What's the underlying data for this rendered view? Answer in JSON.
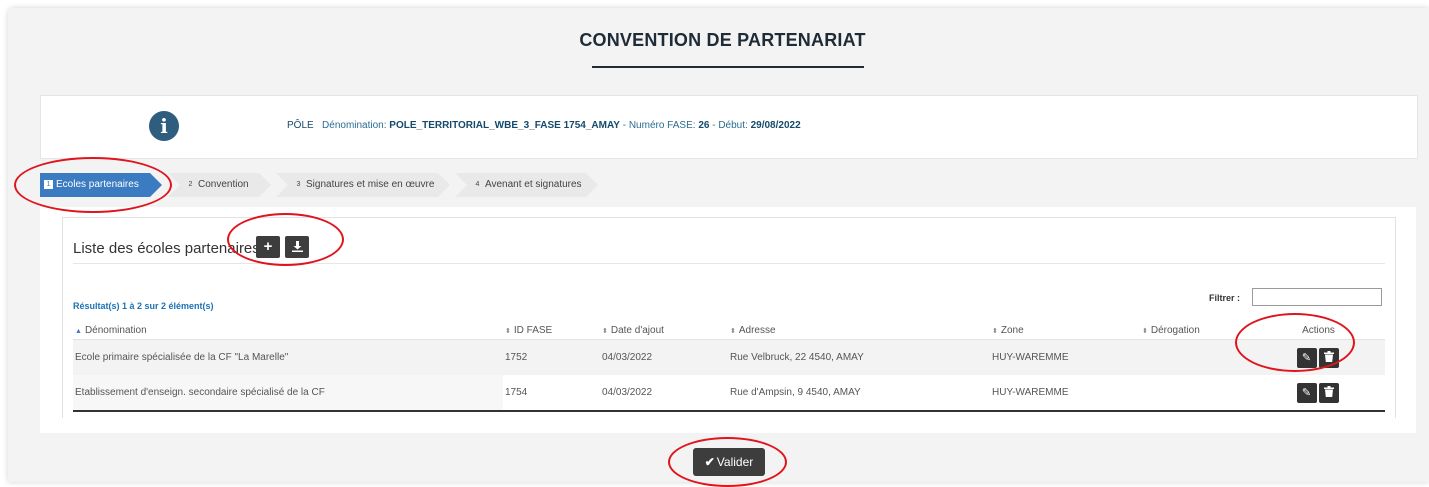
{
  "page": {
    "title": "CONVENTION DE PARTENARIAT"
  },
  "info": {
    "type": "PÔLE",
    "denomination_label": "Dénomination:",
    "denomination_value": "POLE_TERRITORIAL_WBE_3_FASE 1754_AMAY",
    "fase_label": "- Numéro FASE:",
    "fase_value": "26",
    "start_label": "- Début:",
    "start_value": "29/08/2022"
  },
  "steps": [
    {
      "num": "1",
      "label": "Ecoles partenaires",
      "active": true
    },
    {
      "num": "2",
      "label": "Convention",
      "active": false
    },
    {
      "num": "3",
      "label": "Signatures et mise en œuvre",
      "active": false
    },
    {
      "num": "4",
      "label": "Avenant et signatures",
      "active": false
    }
  ],
  "list": {
    "title": "Liste des écoles partenaires",
    "add_icon": "plus-icon",
    "download_icon": "download-icon",
    "result_text": "Résultat(s) 1 à 2 sur 2 élément(s)",
    "filter_label": "Filtrer :",
    "filter_value": "",
    "columns": [
      "Dénomination",
      "ID FASE",
      "Date d'ajout",
      "Adresse",
      "Zone",
      "Dérogation",
      "Actions"
    ],
    "rows": [
      {
        "denomination": "Ecole primaire spécialisée de la CF \"La Marelle\"",
        "id_fase": "1752",
        "date": "04/03/2022",
        "adresse": "Rue Velbruck, 22 4540, AMAY",
        "zone": "HUY-WAREMME",
        "derogation": ""
      },
      {
        "denomination": "Etablissement d'enseign. secondaire spécialisé de la CF",
        "id_fase": "1754",
        "date": "04/03/2022",
        "adresse": "Rue d'Ampsin, 9 4540, AMAY",
        "zone": "HUY-WAREMME",
        "derogation": ""
      }
    ],
    "row_actions": [
      "edit-icon",
      "trash-icon"
    ]
  },
  "validate_button": {
    "label": "Valider",
    "icon": "checkmark-icon"
  },
  "colors": {
    "accent": "#3a7bc1",
    "info_icon": "#2e5d7e",
    "link": "#1b72b5",
    "annotation": "#e0141c",
    "dark_button": "#3d3d3d"
  }
}
